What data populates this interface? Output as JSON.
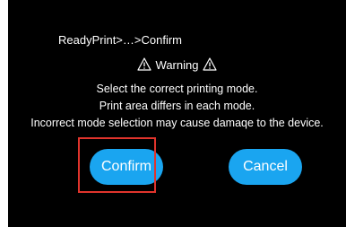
{
  "breadcrumb": {
    "text": "ReadyPrint>…>Confirm"
  },
  "warning": {
    "title": "Warning",
    "icon": "warning-triangle-icon"
  },
  "messages": {
    "line1": "Select the correct printing mode.",
    "line2": "Print area differs in each mode.",
    "line3": "Incorrect mode selection may cause damaqe to the device."
  },
  "buttons": {
    "confirm_label": "Confirm",
    "cancel_label": "Cancel"
  },
  "colors": {
    "background": "#000000",
    "button": "#1aa5f0",
    "highlight": "#e0342c",
    "text": "#ffffff"
  }
}
